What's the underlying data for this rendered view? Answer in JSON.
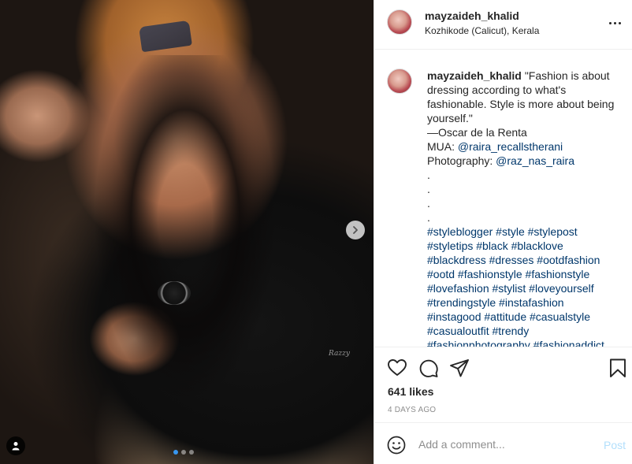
{
  "media": {
    "watermark": "Razzy",
    "carousel_dots": 3,
    "active_dot": 0
  },
  "post": {
    "username": "mayzaideh_khalid",
    "location": "Kozhikode (Calicut), Kerala"
  },
  "caption": {
    "username": "mayzaideh_khalid",
    "quote_lines": [
      "\"Fashion is about",
      "dressing according to what's",
      "fashionable. Style is more about being",
      "yourself.\""
    ],
    "author": "—Oscar de la Renta",
    "mua_label": "MUA: ",
    "mua_handle": "@raira_recallstherani",
    "photo_label": "Photography: ",
    "photo_handle": "@raz_nas_raira",
    "dots": [
      ".",
      ".",
      ".",
      "."
    ],
    "hashtag_lines": [
      "#styleblogger #style #stylepost",
      "#styletips #black #blacklove",
      "#blackdress #dresses #ootdfashion",
      "#ootd #fashionstyle #fashionstyle",
      "#lovefashion #stylist #loveyourself",
      "#trendingstyle #instafashion",
      "#instagood #attitude #casualstyle",
      "#casualoutfit #trendy",
      "#fashionphotography #fashionaddict"
    ]
  },
  "actions": {
    "likes": "641 likes",
    "time": "4 DAYS AGO"
  },
  "comment_box": {
    "placeholder": "Add a comment...",
    "post_label": "Post"
  },
  "icons": {
    "like": "heart-icon",
    "comment": "comment-icon",
    "share": "paper-plane-icon",
    "save": "bookmark-icon",
    "emoji": "smiley-icon",
    "more": "ellipsis-icon",
    "next": "chevron-right-icon",
    "tag": "user-icon"
  },
  "colors": {
    "link": "#00376b",
    "text": "#262626",
    "muted": "#8e8e8e",
    "post_disabled": "#b2dffc",
    "active_dot": "#3897f0"
  }
}
